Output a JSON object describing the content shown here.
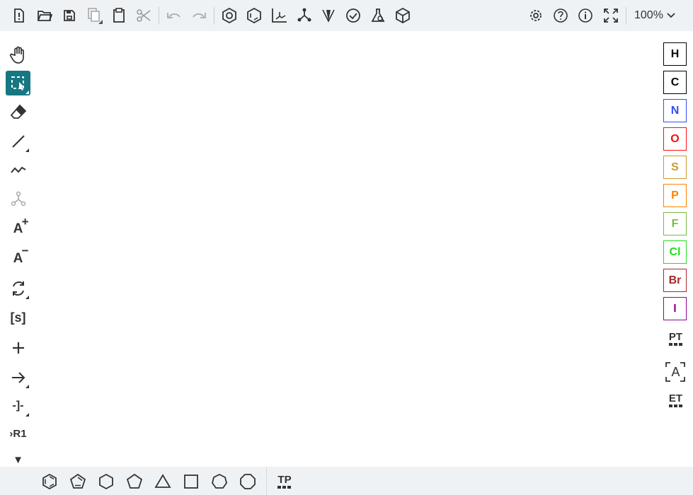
{
  "toolbar": {
    "icons": [
      "new-file-icon",
      "open-folder-icon",
      "save-icon",
      "copy-icon",
      "paste-icon",
      "cut-icon",
      "undo-icon",
      "redo-icon",
      "aromatize-icon",
      "dearomatize-icon",
      "layout-icon",
      "clean-icon",
      "stereo-icon",
      "check-icon",
      "calculate-icon",
      "3d-view-icon",
      "settings-icon",
      "help-icon",
      "about-icon",
      "fullscreen-icon"
    ],
    "zoom": "100%"
  },
  "left_tools": [
    "hand",
    "select",
    "erase",
    "bond",
    "chain",
    "template-atom",
    "charge-plus",
    "charge-minus",
    "transform",
    "sgroup",
    "plus",
    "arrow",
    "rgroup-label",
    "rgroup-fragment",
    "more"
  ],
  "left_text": {
    "a_plus": "A",
    "a_minus": "A",
    "sgroup": "[s]",
    "rgroup_label": "-]-",
    "rgroup_fragment": "›R1",
    "more": "▼"
  },
  "elements": [
    {
      "symbol": "H",
      "color": "#000000"
    },
    {
      "symbol": "C",
      "color": "#000000"
    },
    {
      "symbol": "N",
      "color": "#304ff7"
    },
    {
      "symbol": "O",
      "color": "#ff0d0d"
    },
    {
      "symbol": "S",
      "color": "#c99a2e"
    },
    {
      "symbol": "P",
      "color": "#ff8000"
    },
    {
      "symbol": "F",
      "color": "#78bc42"
    },
    {
      "symbol": "Cl",
      "color": "#1fe01f"
    },
    {
      "symbol": "Br",
      "color": "#a62929"
    },
    {
      "symbol": "I",
      "color": "#940094"
    }
  ],
  "right_extra": {
    "periodic_table": "PT",
    "any_atom": "A",
    "extended_table": "ET"
  },
  "bottom": {
    "shapes": [
      "benzene",
      "cyclopentadiene",
      "cyclohexane",
      "cyclopentane",
      "cyclopropane",
      "cyclobutane",
      "cycloheptane",
      "cyclooctane"
    ],
    "template_library": "TP"
  },
  "colors": {
    "accent": "#167782",
    "toolbar_bg": "#eff2f5"
  }
}
